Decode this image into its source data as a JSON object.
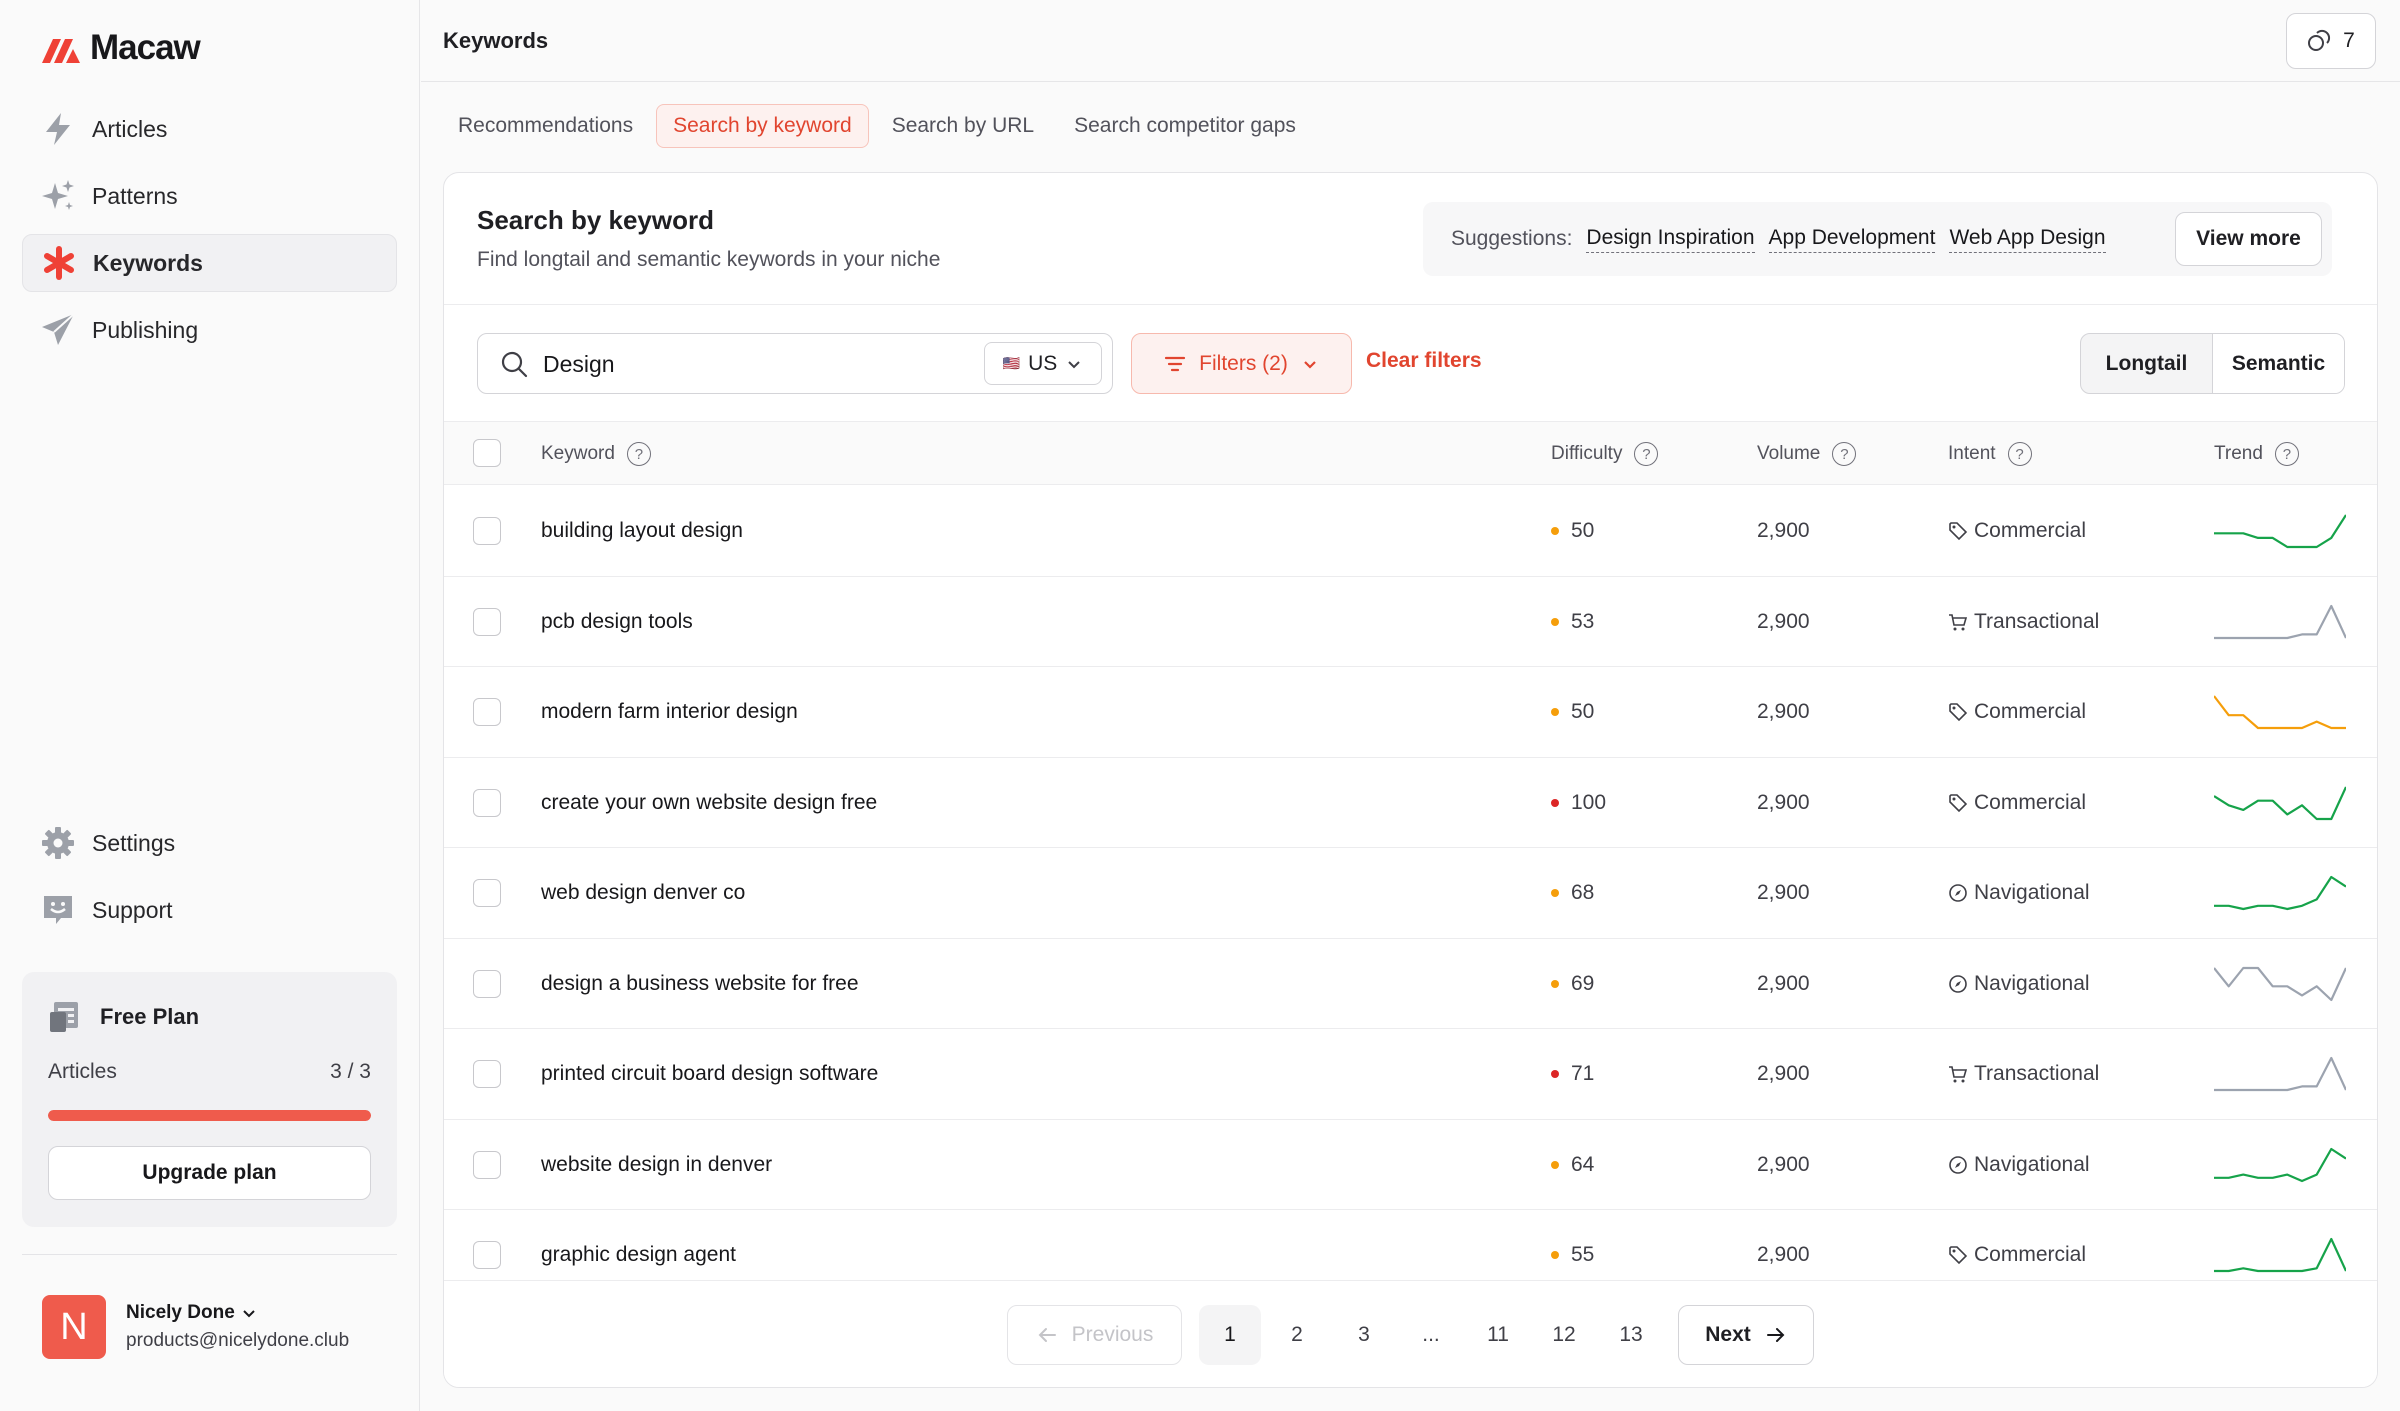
{
  "app": {
    "name": "Macaw",
    "brand_color": "#ef5b4c"
  },
  "sidebar": {
    "nav": [
      {
        "label": "Articles",
        "icon": "bolt-icon"
      },
      {
        "label": "Patterns",
        "icon": "sparkles-icon"
      },
      {
        "label": "Keywords",
        "icon": "asterisk-icon",
        "active": true
      },
      {
        "label": "Publishing",
        "icon": "paper-plane-icon"
      }
    ],
    "bottom": [
      {
        "label": "Settings",
        "icon": "gear-icon"
      },
      {
        "label": "Support",
        "icon": "smiley-icon"
      }
    ],
    "plan": {
      "name": "Free Plan",
      "metric_label": "Articles",
      "metric_value": "3 / 3",
      "usage": 1.0,
      "upgrade_label": "Upgrade plan"
    },
    "user": {
      "initial": "N",
      "name": "Nicely Done",
      "email": "products@nicelydone.club"
    }
  },
  "header": {
    "title": "Keywords",
    "credits": "7"
  },
  "tabs": [
    {
      "label": "Recommendations"
    },
    {
      "label": "Search by keyword",
      "active": true
    },
    {
      "label": "Search by URL"
    },
    {
      "label": "Search competitor gaps"
    }
  ],
  "panel": {
    "title": "Search by keyword",
    "subtitle": "Find longtail and semantic keywords in your niche",
    "suggestions_label": "Suggestions:",
    "suggestions": [
      "Design Inspiration",
      "App Development",
      "Web App Design"
    ],
    "view_more": "View more"
  },
  "toolbar": {
    "search_value": "Design",
    "country": "US",
    "country_flag": "🇺🇸",
    "filters_label": "Filters (2)",
    "clear_label": "Clear filters",
    "mode_options": [
      "Longtail",
      "Semantic"
    ]
  },
  "table": {
    "columns": {
      "keyword": "Keyword",
      "difficulty": "Difficulty",
      "volume": "Volume",
      "intent": "Intent",
      "trend": "Trend"
    },
    "rows": [
      {
        "keyword": "building layout design",
        "difficulty": "50",
        "difficulty_color": "#f59e0b",
        "volume": "2,900",
        "intent": "Commercial",
        "intent_icon": "tag-icon",
        "trend_color": "#16a34a",
        "trend": [
          6,
          6,
          6,
          5,
          5,
          3,
          3,
          3,
          5,
          10
        ]
      },
      {
        "keyword": "pcb design tools",
        "difficulty": "53",
        "difficulty_color": "#f59e0b",
        "volume": "2,900",
        "intent": "Transactional",
        "intent_icon": "cart-icon",
        "trend_color": "#9ca3af",
        "trend": [
          3,
          3,
          3,
          3,
          3,
          3,
          4,
          4,
          12,
          3
        ]
      },
      {
        "keyword": "modern farm interior design",
        "difficulty": "50",
        "difficulty_color": "#f59e0b",
        "volume": "2,900",
        "intent": "Commercial",
        "intent_icon": "tag-icon",
        "trend_color": "#f59e0b",
        "trend": [
          10,
          7,
          7,
          5,
          5,
          5,
          5,
          6,
          5,
          5
        ]
      },
      {
        "keyword": "create your own website design free",
        "difficulty": "100",
        "difficulty_color": "#dc2626",
        "volume": "2,900",
        "intent": "Commercial",
        "intent_icon": "tag-icon",
        "trend_color": "#16a34a",
        "trend": [
          8,
          6,
          5,
          7,
          7,
          4,
          6,
          3,
          3,
          10
        ]
      },
      {
        "keyword": "web design denver co",
        "difficulty": "68",
        "difficulty_color": "#f59e0b",
        "volume": "2,900",
        "intent": "Navigational",
        "intent_icon": "compass-icon",
        "trend_color": "#16a34a",
        "trend": [
          3,
          3,
          2,
          3,
          3,
          2,
          3,
          5,
          12,
          9
        ]
      },
      {
        "keyword": "design a business website for free",
        "difficulty": "69",
        "difficulty_color": "#f59e0b",
        "volume": "2,900",
        "intent": "Navigational",
        "intent_icon": "compass-icon",
        "trend_color": "#9ca3af",
        "trend": [
          10,
          6,
          10,
          10,
          6,
          6,
          4,
          6,
          3,
          10
        ]
      },
      {
        "keyword": "printed circuit board design software",
        "difficulty": "71",
        "difficulty_color": "#dc2626",
        "volume": "2,900",
        "intent": "Transactional",
        "intent_icon": "cart-icon",
        "trend_color": "#9ca3af",
        "trend": [
          3,
          3,
          3,
          3,
          3,
          3,
          4,
          4,
          12,
          3
        ]
      },
      {
        "keyword": "website design in denver",
        "difficulty": "64",
        "difficulty_color": "#f59e0b",
        "volume": "2,900",
        "intent": "Navigational",
        "intent_icon": "compass-icon",
        "trend_color": "#16a34a",
        "trend": [
          3,
          3,
          4,
          3,
          3,
          4,
          2,
          4,
          12,
          9
        ]
      },
      {
        "keyword": "graphic design agent",
        "difficulty": "55",
        "difficulty_color": "#f59e0b",
        "volume": "2,900",
        "intent": "Commercial",
        "intent_icon": "tag-icon",
        "trend_color": "#16a34a",
        "trend": [
          2,
          2,
          3,
          2,
          2,
          2,
          2,
          3,
          14,
          2
        ]
      }
    ]
  },
  "pagination": {
    "prev": "Previous",
    "next": "Next",
    "pages": [
      "1",
      "2",
      "3",
      "...",
      "11",
      "12",
      "13"
    ],
    "current": "1"
  }
}
